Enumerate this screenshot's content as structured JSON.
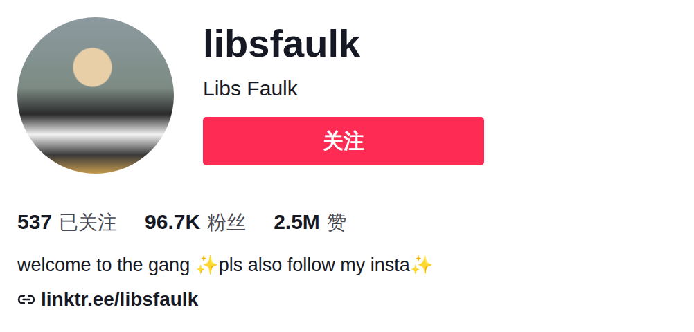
{
  "profile": {
    "username": "libsfaulk",
    "display_name": "Libs Faulk"
  },
  "follow_button": {
    "label": "关注"
  },
  "stats": [
    {
      "value": "537",
      "label": "已关注"
    },
    {
      "value": "96.7K",
      "label": "粉丝"
    },
    {
      "value": "2.5M",
      "label": "赞"
    }
  ],
  "bio": "welcome to the gang ✨pls also follow my insta✨",
  "link": {
    "text": "linktr.ee/libsfaulk"
  }
}
